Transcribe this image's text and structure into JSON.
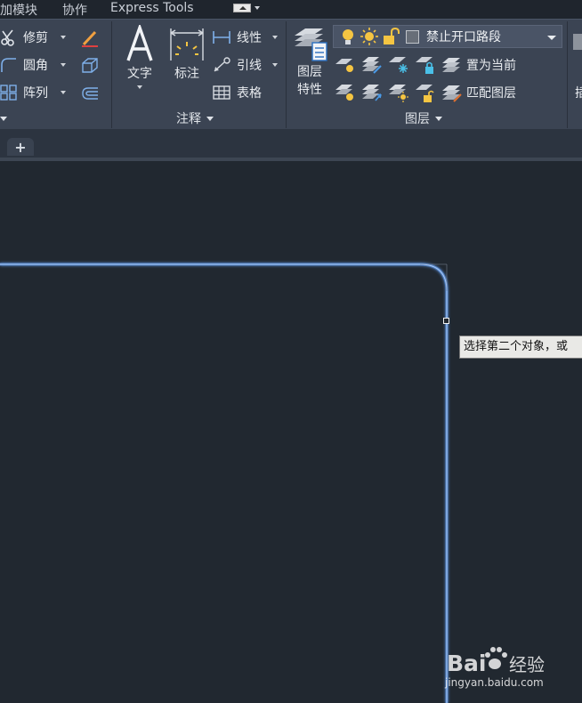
{
  "menu_tabs": [
    {
      "label": "加模块"
    },
    {
      "label": "协作"
    },
    {
      "label": "Express Tools"
    }
  ],
  "modify_panel": {
    "trim_label": "修剪",
    "fillet_label": "圆角",
    "array_label": "阵列"
  },
  "annotation_panel": {
    "text_label": "文字",
    "dimension_label": "标注",
    "linear_label": "线性",
    "leader_label": "引线",
    "table_label": "表格",
    "footer_label": "注释"
  },
  "layers_panel": {
    "properties_label_1": "图层",
    "properties_label_2": "特性",
    "current_layer": "禁止开口路段",
    "set_current_label": "置为当前",
    "match_layer_label": "匹配图层",
    "footer_label": "图层"
  },
  "right_panel": {
    "partial_label": "插"
  },
  "file_tabs": {
    "new_tab_label": "+"
  },
  "canvas": {
    "tooltip_text": "选择第二个对象，或",
    "selection_color": "#6b9fe8"
  },
  "watermark": {
    "logo": "Bai 经验",
    "url": "jingyan.baidu.com"
  },
  "colors": {
    "ribbon_bg": "#3b4453",
    "canvas_bg": "#212830",
    "bulb_yellow": "#f5c542"
  }
}
